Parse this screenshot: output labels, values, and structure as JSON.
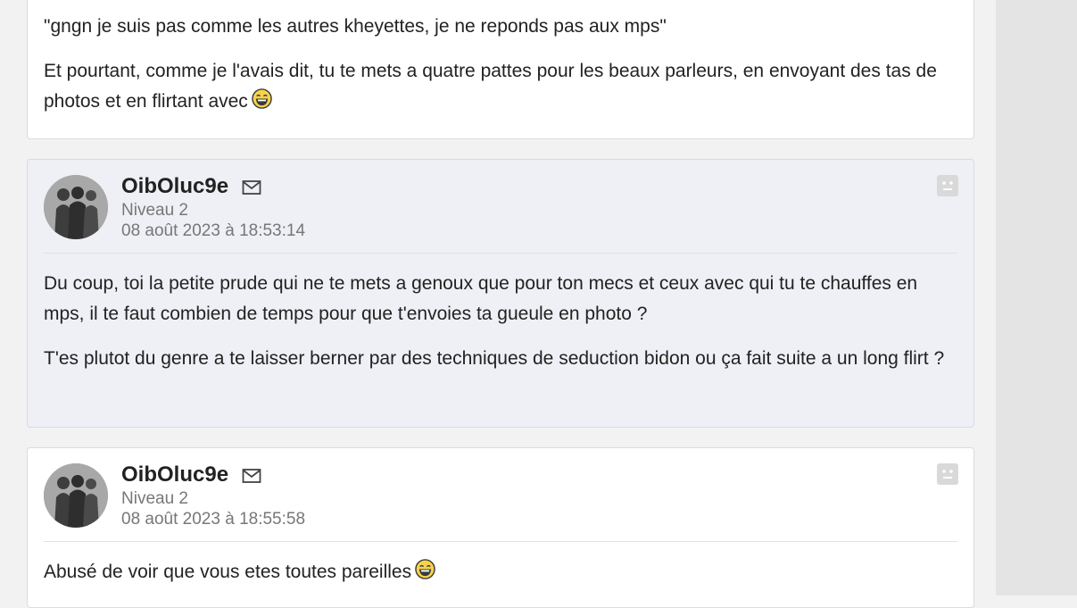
{
  "posts": [
    {
      "paragraphs": [
        "\"gngn je suis pas comme les autres kheyettes, je ne reponds pas aux mps\"",
        "Et pourtant, comme je l'avais dit, tu te mets a quatre pattes pour les beaux parleurs, en envoyant des tas de photos et en flirtant avec"
      ],
      "emoji": "laughing-smiley-icon"
    },
    {
      "author": "OibOluc9e",
      "level": "Niveau 2",
      "date": "08 août 2023 à 18:53:14",
      "paragraphs": [
        "Du coup, toi la petite prude qui ne te mets a genoux que pour ton mecs et ceux avec qui tu te chauffes en mps, il te faut combien de temps pour que t'envoies ta gueule en photo ?",
        "T'es plutot du genre a te laisser berner par des techniques de seduction bidon ou ça fait suite a un long flirt ?"
      ]
    },
    {
      "author": "OibOluc9e",
      "level": "Niveau 2",
      "date": "08 août 2023 à 18:55:58",
      "paragraphs": [
        "Abusé de voir que vous etes toutes pareilles"
      ],
      "emoji": "laughing-smiley-icon"
    }
  ],
  "colors": {
    "page_bg": "#f2f2f2",
    "post_bg": "#ffffff",
    "post_alt_bg": "#eef0f5",
    "meta_text": "#777777"
  }
}
